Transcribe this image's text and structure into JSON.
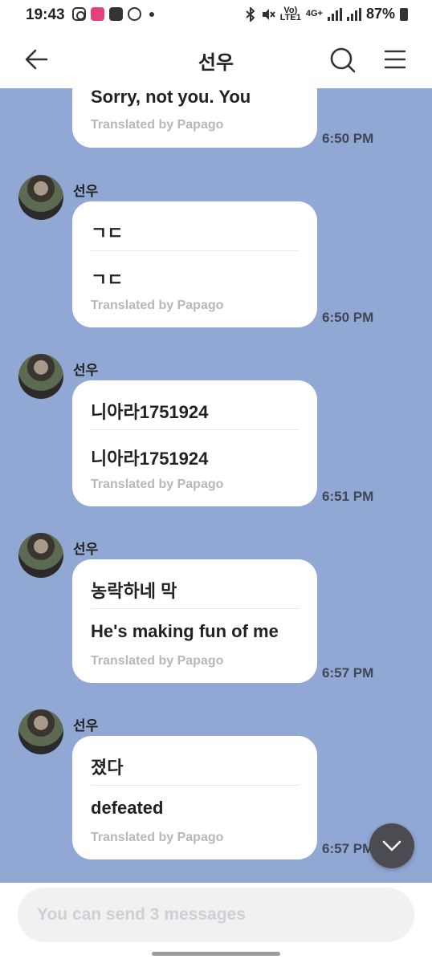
{
  "status_bar": {
    "time": "19:43",
    "network_top": "Vo)",
    "network_bottom": "LTE1",
    "net2_top": "4G+",
    "battery": "87%"
  },
  "header": {
    "title": "선우"
  },
  "messages": [
    {
      "sender": "",
      "text": "Sorry, not you. You",
      "translation": "",
      "translated_by": "Translated by Papago",
      "time": "6:50 PM"
    },
    {
      "sender": "선우",
      "text": "ㄱㄷ",
      "translation": "ㄱㄷ",
      "translated_by": "Translated by Papago",
      "time": "6:50 PM"
    },
    {
      "sender": "선우",
      "text": "니아라1751924",
      "translation": "니아라1751924",
      "translated_by": "Translated by Papago",
      "time": "6:51 PM"
    },
    {
      "sender": "선우",
      "text": "농락하네 막",
      "translation": "He's making fun of me",
      "translated_by": "Translated by Papago",
      "time": "6:57 PM"
    },
    {
      "sender": "선우",
      "text": "졌다",
      "translation": "defeated",
      "translated_by": "Translated by Papago",
      "time": "6:57 PM"
    }
  ],
  "composer": {
    "placeholder": "You can send 3 messages"
  },
  "icons": {
    "back": "arrow-left-icon",
    "search": "search-icon",
    "menu": "menu-icon",
    "scroll": "chevron-down-icon"
  },
  "colors": {
    "chat_background": "#91a8d4",
    "bubble": "#ffffff",
    "scroll_button": "#4b4c52"
  }
}
